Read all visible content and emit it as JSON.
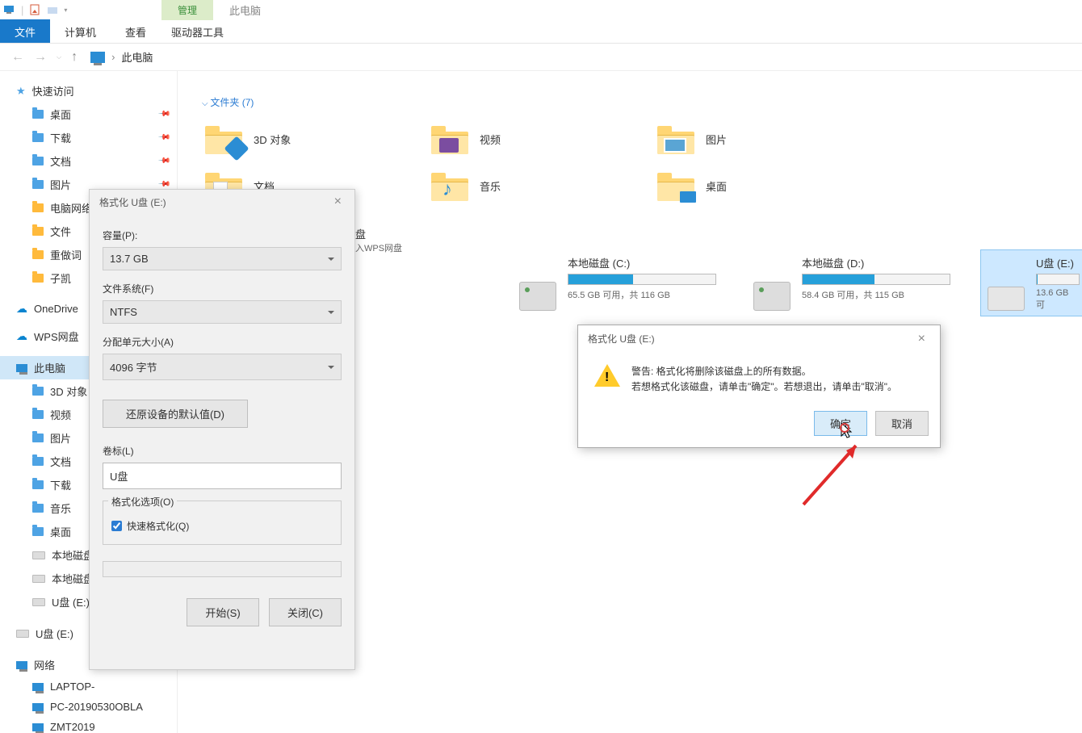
{
  "titlebar": {
    "manage": "管理",
    "location": "此电脑"
  },
  "ribbon": {
    "file": "文件",
    "computer": "计算机",
    "view": "查看",
    "drive_tools": "驱动器工具"
  },
  "breadcrumb": {
    "label": "此电脑"
  },
  "sidebar": {
    "quick_access": "快速访问",
    "pinned": [
      {
        "label": "桌面"
      },
      {
        "label": "下载"
      },
      {
        "label": "文档"
      },
      {
        "label": "图片"
      },
      {
        "label": "电脑网络"
      },
      {
        "label": "文件"
      },
      {
        "label": "重做词"
      },
      {
        "label": "子凯"
      }
    ],
    "onedrive": "OneDrive",
    "wps": "WPS网盘",
    "this_pc": "此电脑",
    "pc_children": [
      {
        "label": "3D 对象"
      },
      {
        "label": "视频"
      },
      {
        "label": "图片"
      },
      {
        "label": "文档"
      },
      {
        "label": "下载"
      },
      {
        "label": "音乐"
      },
      {
        "label": "桌面"
      },
      {
        "label": "本地磁盘"
      },
      {
        "label": "本地磁盘"
      },
      {
        "label": "U盘 (E:)"
      }
    ],
    "usb": "U盘 (E:)",
    "network": "网络",
    "net_children": [
      {
        "label": "LAPTOP-"
      },
      {
        "label": "PC-20190530OBLA"
      },
      {
        "label": "ZMT2019"
      }
    ]
  },
  "content": {
    "folders_header": "文件夹 (7)",
    "folders": [
      {
        "label": "3D 对象"
      },
      {
        "label": "视频"
      },
      {
        "label": "图片"
      },
      {
        "label": "文档"
      },
      {
        "label": "音乐"
      },
      {
        "label": "桌面"
      }
    ],
    "wps_sub": "入WPS网盘",
    "wps_label": "盘",
    "drives": [
      {
        "name": "本地磁盘 (C:)",
        "fill": 44,
        "sub": "65.5 GB 可用，共 116 GB"
      },
      {
        "name": "本地磁盘 (D:)",
        "fill": 49,
        "sub": "58.4 GB 可用，共 115 GB"
      },
      {
        "name": "U盘 (E:)",
        "fill": 2,
        "sub": "13.6 GB 可"
      }
    ]
  },
  "format_dialog": {
    "title": "格式化 U盘 (E:)",
    "capacity_lbl": "容量(P):",
    "capacity": "13.7 GB",
    "fs_lbl": "文件系统(F)",
    "fs": "NTFS",
    "alloc_lbl": "分配单元大小(A)",
    "alloc": "4096 字节",
    "restore": "还原设备的默认值(D)",
    "vol_lbl": "卷标(L)",
    "vol": "U盘",
    "opts_lbl": "格式化选项(O)",
    "quick": "快速格式化(Q)",
    "start": "开始(S)",
    "close": "关闭(C)"
  },
  "confirm_dialog": {
    "title": "格式化 U盘 (E:)",
    "line1": "警告: 格式化将删除该磁盘上的所有数据。",
    "line2": "若想格式化该磁盘，请单击\"确定\"。若想退出，请单击\"取消\"。",
    "ok": "确定",
    "cancel": "取消"
  }
}
